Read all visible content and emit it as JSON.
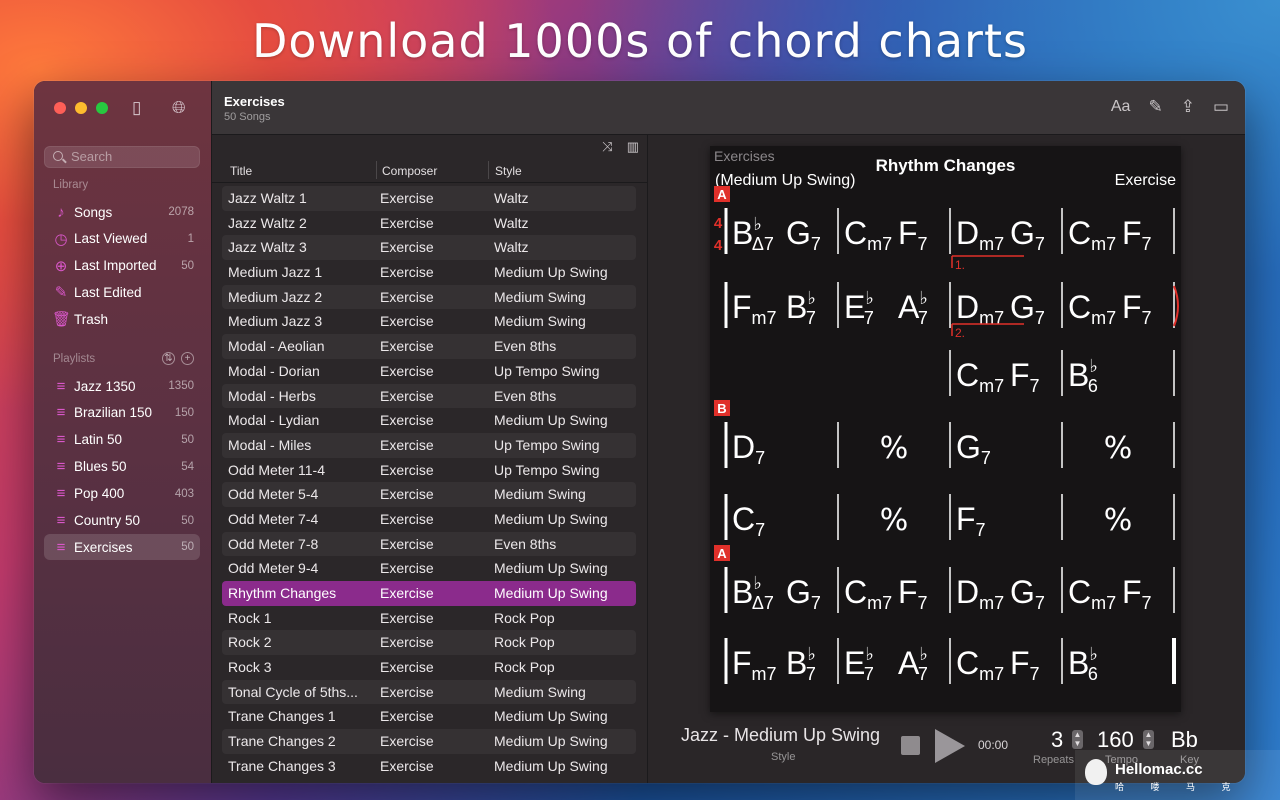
{
  "headline": "Download 1000s of chord charts",
  "sidebar": {
    "search_placeholder": "Search",
    "library_label": "Library",
    "library": [
      {
        "label": "Songs",
        "count": "2078",
        "icon": "music-note-icon"
      },
      {
        "label": "Last Viewed",
        "count": "1",
        "icon": "clock-icon"
      },
      {
        "label": "Last Imported",
        "count": "50",
        "icon": "download-circle-icon"
      },
      {
        "label": "Last Edited",
        "count": "",
        "icon": "edit-square-icon"
      },
      {
        "label": "Trash",
        "count": "",
        "icon": "trash-icon"
      }
    ],
    "playlists_label": "Playlists",
    "playlists": [
      {
        "label": "Jazz 1350",
        "count": "1350"
      },
      {
        "label": "Brazilian 150",
        "count": "150"
      },
      {
        "label": "Latin 50",
        "count": "50"
      },
      {
        "label": "Blues 50",
        "count": "54"
      },
      {
        "label": "Pop 400",
        "count": "403"
      },
      {
        "label": "Country 50",
        "count": "50"
      },
      {
        "label": "Exercises",
        "count": "50",
        "selected": true
      }
    ]
  },
  "toolbar": {
    "title": "Exercises",
    "subtitle": "50 Songs",
    "font_button": "Aa"
  },
  "list": {
    "columns": [
      "Title",
      "Composer",
      "Style"
    ],
    "rows": [
      [
        "Jazz Waltz 1",
        "Exercise",
        "Waltz"
      ],
      [
        "Jazz Waltz 2",
        "Exercise",
        "Waltz"
      ],
      [
        "Jazz Waltz 3",
        "Exercise",
        "Waltz"
      ],
      [
        "Medium Jazz 1",
        "Exercise",
        "Medium Up Swing"
      ],
      [
        "Medium Jazz 2",
        "Exercise",
        "Medium Swing"
      ],
      [
        "Medium Jazz 3",
        "Exercise",
        "Medium Swing"
      ],
      [
        "Modal - Aeolian",
        "Exercise",
        "Even 8ths"
      ],
      [
        "Modal - Dorian",
        "Exercise",
        "Up Tempo Swing"
      ],
      [
        "Modal - Herbs",
        "Exercise",
        "Even 8ths"
      ],
      [
        "Modal - Lydian",
        "Exercise",
        "Medium Up Swing"
      ],
      [
        "Modal - Miles",
        "Exercise",
        "Up Tempo Swing"
      ],
      [
        "Odd Meter 11-4",
        "Exercise",
        "Up Tempo Swing"
      ],
      [
        "Odd Meter 5-4",
        "Exercise",
        "Medium Swing"
      ],
      [
        "Odd Meter 7-4",
        "Exercise",
        "Medium Up Swing"
      ],
      [
        "Odd Meter 7-8",
        "Exercise",
        "Even 8ths"
      ],
      [
        "Odd Meter 9-4",
        "Exercise",
        "Medium Up Swing"
      ],
      [
        "Rhythm Changes",
        "Exercise",
        "Medium Up Swing"
      ],
      [
        "Rock 1",
        "Exercise",
        "Rock Pop"
      ],
      [
        "Rock 2",
        "Exercise",
        "Rock Pop"
      ],
      [
        "Rock 3",
        "Exercise",
        "Rock Pop"
      ],
      [
        "Tonal Cycle of 5ths...",
        "Exercise",
        "Medium Swing"
      ],
      [
        "Trane Changes 1",
        "Exercise",
        "Medium Up Swing"
      ],
      [
        "Trane Changes 2",
        "Exercise",
        "Medium Up Swing"
      ],
      [
        "Trane Changes 3",
        "Exercise",
        "Medium Up Swing"
      ]
    ],
    "selected_index": 16
  },
  "chart": {
    "category": "Exercises",
    "title": "Rhythm Changes",
    "style": "(Medium Up Swing)",
    "composer": "Exercise",
    "time_signature": [
      "4",
      "4"
    ],
    "rows": [
      {
        "section": "A",
        "bars": [
          [
            "B♭Δ7",
            "G7"
          ],
          [
            "Cm7",
            "F7"
          ],
          [
            "Dm7",
            "G7"
          ],
          [
            "Cm7",
            "F7"
          ]
        ]
      },
      {
        "section": "",
        "ending": "1.",
        "bars": [
          [
            "Fm7",
            "B♭7"
          ],
          [
            "E♭7",
            "A♭7"
          ],
          [
            "Dm7",
            "G7"
          ],
          [
            "Cm7",
            "F7"
          ]
        ]
      },
      {
        "section": "",
        "ending": "2.",
        "bars": [
          [],
          [],
          [
            "Cm7",
            "F7"
          ],
          [
            "B♭6"
          ]
        ]
      },
      {
        "section": "B",
        "bars": [
          [
            "D7"
          ],
          [
            "%"
          ],
          [
            "G7"
          ],
          [
            "%"
          ]
        ]
      },
      {
        "section": "",
        "bars": [
          [
            "C7"
          ],
          [
            "%"
          ],
          [
            "F7"
          ],
          [
            "%"
          ]
        ]
      },
      {
        "section": "A",
        "bars": [
          [
            "B♭Δ7",
            "G7"
          ],
          [
            "Cm7",
            "F7"
          ],
          [
            "Dm7",
            "G7"
          ],
          [
            "Cm7",
            "F7"
          ]
        ]
      },
      {
        "section": "",
        "bars": [
          [
            "Fm7",
            "B♭7"
          ],
          [
            "E♭7",
            "A♭7"
          ],
          [
            "Cm7",
            "F7"
          ],
          [
            "B♭6"
          ]
        ]
      }
    ]
  },
  "transport": {
    "style": "Jazz - Medium Up Swing",
    "style_label": "Style",
    "time": "00:00",
    "repeats": "3",
    "repeats_label": "Repeats",
    "tempo": "160",
    "tempo_label": "Tempo",
    "key": "Bb",
    "key_label": "Key"
  },
  "watermark": {
    "name": "Hellomac.cc",
    "sub": "哈 喽 马 克"
  }
}
